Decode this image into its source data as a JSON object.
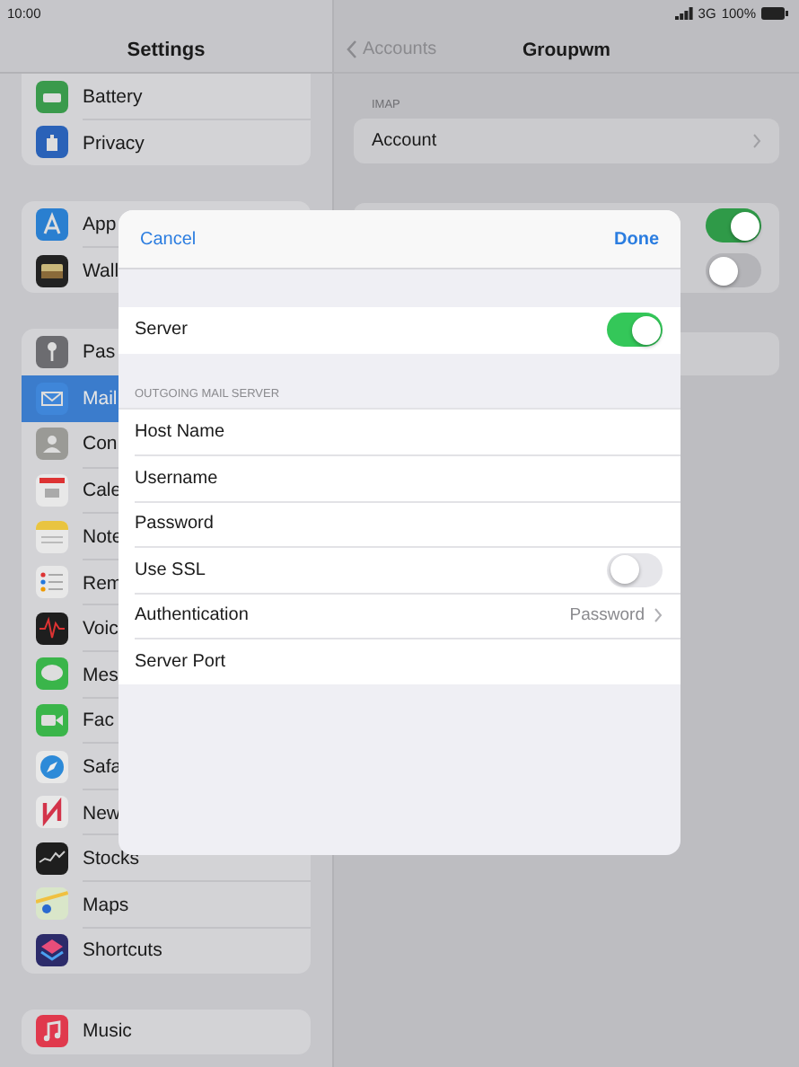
{
  "status_bar": {
    "time": "10:00",
    "network": "3G",
    "battery": "100%"
  },
  "sidebar": {
    "title": "Settings",
    "groups": [
      {
        "items": [
          {
            "label": "Battery",
            "kind": "battery",
            "selected": false
          },
          {
            "label": "Privacy",
            "kind": "hand",
            "selected": false
          }
        ]
      },
      {
        "items": [
          {
            "label": "App",
            "kind": "store",
            "selected": false
          },
          {
            "label": "Wall",
            "kind": "wallet",
            "selected": false
          }
        ]
      },
      {
        "items": [
          {
            "label": "Pas",
            "kind": "key",
            "selected": false
          },
          {
            "label": "Mail",
            "kind": "mail",
            "selected": true
          },
          {
            "label": "Con",
            "kind": "contact",
            "selected": false
          },
          {
            "label": "Cale",
            "kind": "calendar",
            "selected": false
          },
          {
            "label": "Note",
            "kind": "notes",
            "selected": false
          },
          {
            "label": "Rem",
            "kind": "list",
            "selected": false
          },
          {
            "label": "Voic",
            "kind": "wave",
            "selected": false
          },
          {
            "label": "Mes",
            "kind": "bubble",
            "selected": false
          },
          {
            "label": "Fac",
            "kind": "video",
            "selected": false
          },
          {
            "label": "Safa",
            "kind": "compass",
            "selected": false
          },
          {
            "label": "New",
            "kind": "news",
            "selected": false
          },
          {
            "label": "Stocks",
            "kind": "chart",
            "selected": false
          },
          {
            "label": "Maps",
            "kind": "map",
            "selected": false
          },
          {
            "label": "Shortcuts",
            "kind": "layers",
            "selected": false
          }
        ]
      },
      {
        "items": [
          {
            "label": "Music",
            "kind": "music",
            "selected": false
          }
        ]
      }
    ]
  },
  "detail": {
    "back": "Accounts",
    "title": "Groupwm",
    "section": "IMAP",
    "account": "Account",
    "toggles": [
      {
        "on": true
      },
      {
        "on": false
      }
    ]
  },
  "modal": {
    "cancel": "Cancel",
    "done": "Done",
    "server": {
      "label": "Server",
      "on": true
    },
    "section": "OUTGOING MAIL SERVER",
    "rows": [
      {
        "label": "Host Name",
        "kind": "text"
      },
      {
        "label": "Username",
        "kind": "text"
      },
      {
        "label": "Password",
        "kind": "text"
      },
      {
        "label": "Use SSL",
        "kind": "toggle",
        "on": false
      },
      {
        "label": "Authentication",
        "kind": "detail",
        "value": "Password"
      },
      {
        "label": "Server Port",
        "kind": "text"
      }
    ]
  }
}
